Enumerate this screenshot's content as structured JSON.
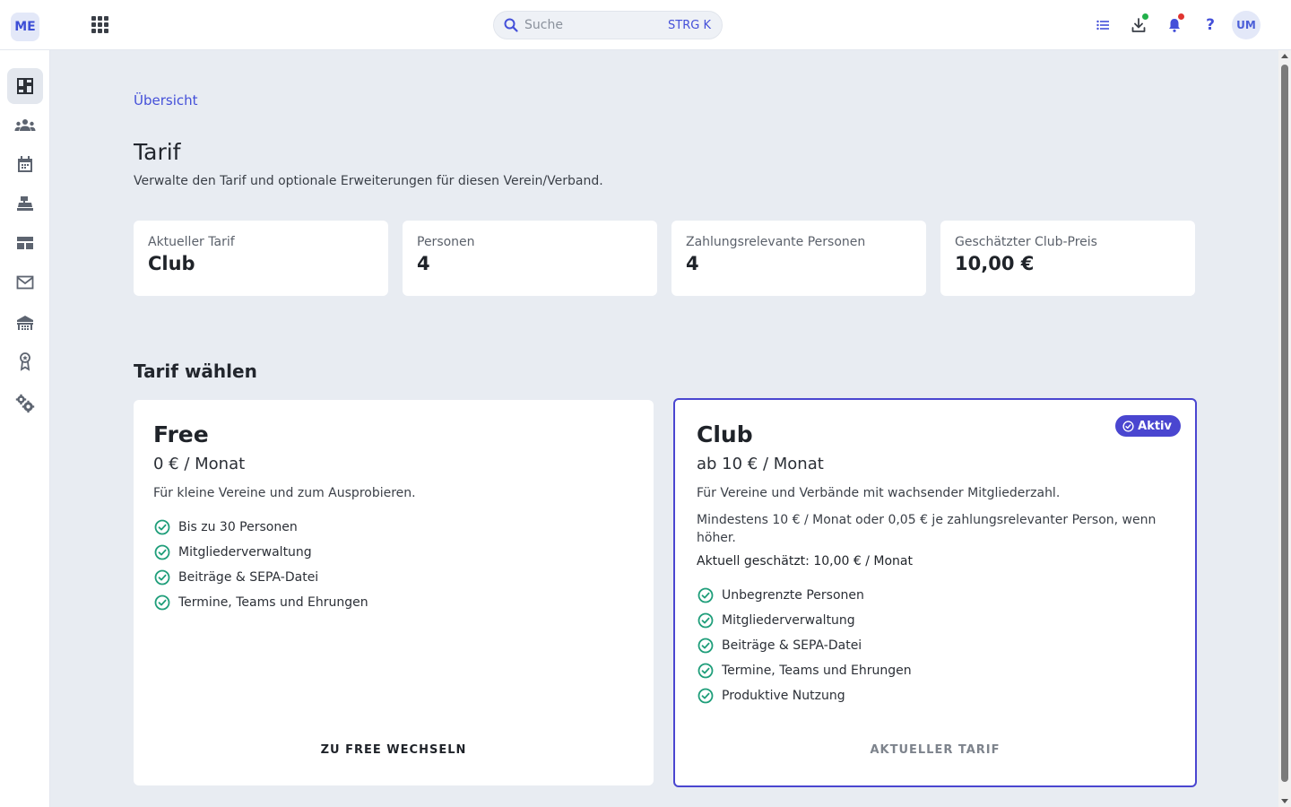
{
  "header": {
    "org_initials": "ME",
    "search": {
      "placeholder": "Suche",
      "shortcut": "STRG K"
    },
    "user_initials": "UM",
    "help_label": "?",
    "icons": [
      "list-icon",
      "download-icon",
      "bell-icon",
      "help-icon"
    ],
    "indicator_colors": {
      "download": "#22b04a",
      "bell": "#e0342f"
    }
  },
  "sidebar": {
    "items": [
      {
        "name": "dashboard",
        "icon": "dashboard-icon",
        "active": true
      },
      {
        "name": "people",
        "icon": "people-icon",
        "active": false
      },
      {
        "name": "calendar",
        "icon": "calendar-icon",
        "active": false
      },
      {
        "name": "finance",
        "icon": "register-icon",
        "active": false
      },
      {
        "name": "tables",
        "icon": "table-icon",
        "active": false
      },
      {
        "name": "mail",
        "icon": "mail-icon",
        "active": false
      },
      {
        "name": "facilities",
        "icon": "building-icon",
        "active": false
      },
      {
        "name": "awards",
        "icon": "award-icon",
        "active": false
      },
      {
        "name": "settings",
        "icon": "gears-icon",
        "active": false
      }
    ]
  },
  "main": {
    "breadcrumb": "Übersicht",
    "title": "Tarif",
    "subtitle": "Verwalte den Tarif und optionale Erweiterungen für diesen Verein/Verband.",
    "stats": [
      {
        "label": "Aktueller Tarif",
        "value": "Club"
      },
      {
        "label": "Personen",
        "value": "4"
      },
      {
        "label": "Zahlungsrelevante Personen",
        "value": "4"
      },
      {
        "label": "Geschätzter Club-Preis",
        "value": "10,00 €"
      }
    ],
    "section_title": "Tarif wählen",
    "plans": {
      "free": {
        "name": "Free",
        "price": "0 € / Monat",
        "description": "Für kleine Vereine und zum Ausprobieren.",
        "features": [
          "Bis zu 30 Personen",
          "Mitgliederverwaltung",
          "Beiträge & SEPA-Datei",
          "Termine, Teams und Ehrungen"
        ],
        "action": "ZU FREE WECHSELN"
      },
      "club": {
        "name": "Club",
        "badge": "Aktiv",
        "price": "ab 10 € / Monat",
        "description": "Für Vereine und Verbände mit wachsender Mitgliederzahl.",
        "note": "Mindestens 10 € / Monat oder 0,05 € je zahlungsrelevanter Person, wenn höher.",
        "estimate": "Aktuell geschätzt: 10,00 € / Monat",
        "features": [
          "Unbegrenzte Personen",
          "Mitgliederverwaltung",
          "Beiträge & SEPA-Datei",
          "Termine, Teams und Ehrungen",
          "Produktive Nutzung"
        ],
        "action": "AKTUELLER TARIF"
      }
    }
  },
  "colors": {
    "accent": "#4a46d0",
    "link": "#4450d9",
    "check": "#1f9e7a",
    "background": "#e8ecf2"
  }
}
